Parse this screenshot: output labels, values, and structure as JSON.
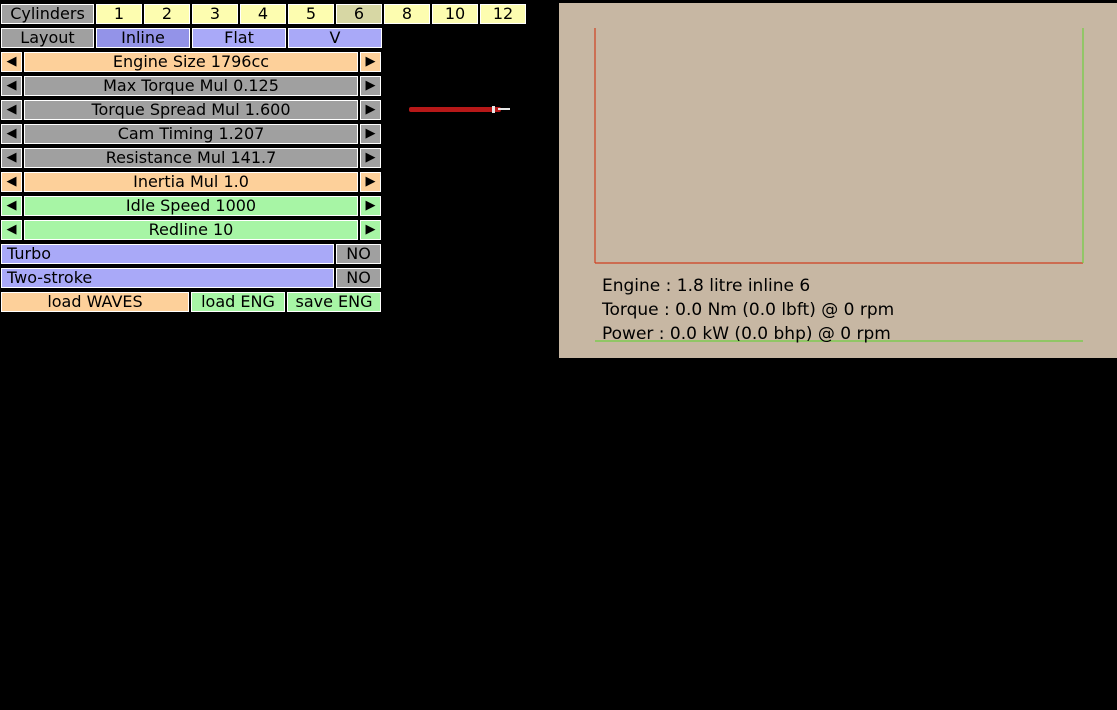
{
  "cylinders": {
    "label": "Cylinders",
    "options": [
      "1",
      "2",
      "3",
      "4",
      "5",
      "6",
      "8",
      "10",
      "12"
    ],
    "selected": "6"
  },
  "layout": {
    "label": "Layout",
    "options": [
      "Inline",
      "Flat",
      "V"
    ],
    "selected": "Inline"
  },
  "params": [
    {
      "label": "Engine Size 1796cc",
      "color": "#fdd09a"
    },
    {
      "label": "Max Torque Mul 0.125",
      "color": "#a0a0a0"
    },
    {
      "label": "Torque Spread Mul 1.600",
      "color": "#a0a0a0"
    },
    {
      "label": "Cam Timing 1.207",
      "color": "#a0a0a0"
    },
    {
      "label": "Resistance Mul 141.7",
      "color": "#a0a0a0"
    },
    {
      "label": "Inertia Mul 1.0",
      "color": "#fdd09a"
    },
    {
      "label": "Idle Speed 1000",
      "color": "#a7f5a5"
    },
    {
      "label": "Redline 10",
      "color": "#a7f5a5"
    }
  ],
  "arrows": {
    "left": "◀",
    "right": "▶"
  },
  "toggles": [
    {
      "label": "Turbo",
      "value": "NO"
    },
    {
      "label": "Two-stroke",
      "value": "NO"
    }
  ],
  "buttons": {
    "load_waves": "load WAVES",
    "load_eng": "load ENG",
    "save_eng": "save ENG"
  },
  "graph": {
    "engine": "Engine : 1.8 litre inline 6",
    "torque": "Torque : 0.0 Nm (0.0 lbft) @ 0 rpm",
    "power": "Power : 0.0 kW (0.0 bhp) @ 0 rpm",
    "colors": {
      "background": "#c7b7a3",
      "torque_line": "#d04020",
      "power_line": "#70d040"
    }
  }
}
